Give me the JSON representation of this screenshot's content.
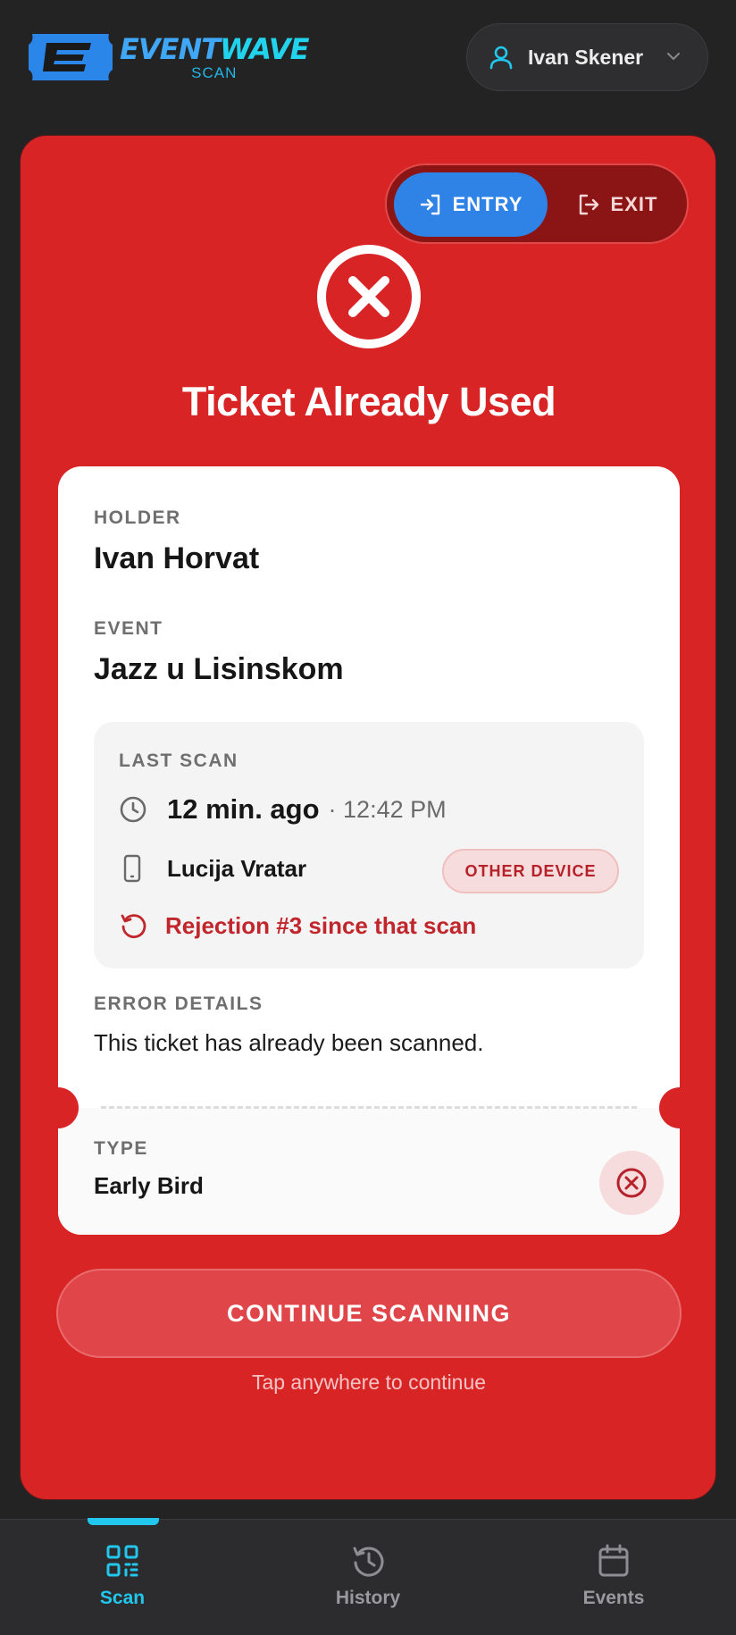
{
  "header": {
    "logo_word_part1": "EVENT",
    "logo_word_part2": "WAVE",
    "logo_sub": "SCAN",
    "user_name": "Ivan Skener"
  },
  "mode_toggle": {
    "entry_label": "ENTRY",
    "exit_label": "EXIT",
    "active": "ENTRY"
  },
  "result": {
    "title": "Ticket Already Used",
    "status_color": "#d92426"
  },
  "ticket": {
    "holder_label": "HOLDER",
    "holder_value": "Ivan Horvat",
    "event_label": "EVENT",
    "event_value": "Jazz u Lisinskom",
    "last_scan": {
      "label": "LAST SCAN",
      "ago": "12 min. ago",
      "time": "· 12:42 PM",
      "scanner": "Lucija Vratar",
      "badge": "OTHER DEVICE",
      "rejection": "Rejection #3 since that scan"
    },
    "error_label": "ERROR DETAILS",
    "error_text": "This ticket has already been scanned.",
    "type_label": "TYPE",
    "type_value": "Early Bird"
  },
  "actions": {
    "continue_label": "CONTINUE SCANNING",
    "tap_hint": "Tap anywhere to continue"
  },
  "bottom_nav": {
    "scan": "Scan",
    "history": "History",
    "events": "Events",
    "active": "Scan",
    "active_color": "#22c7ee"
  }
}
